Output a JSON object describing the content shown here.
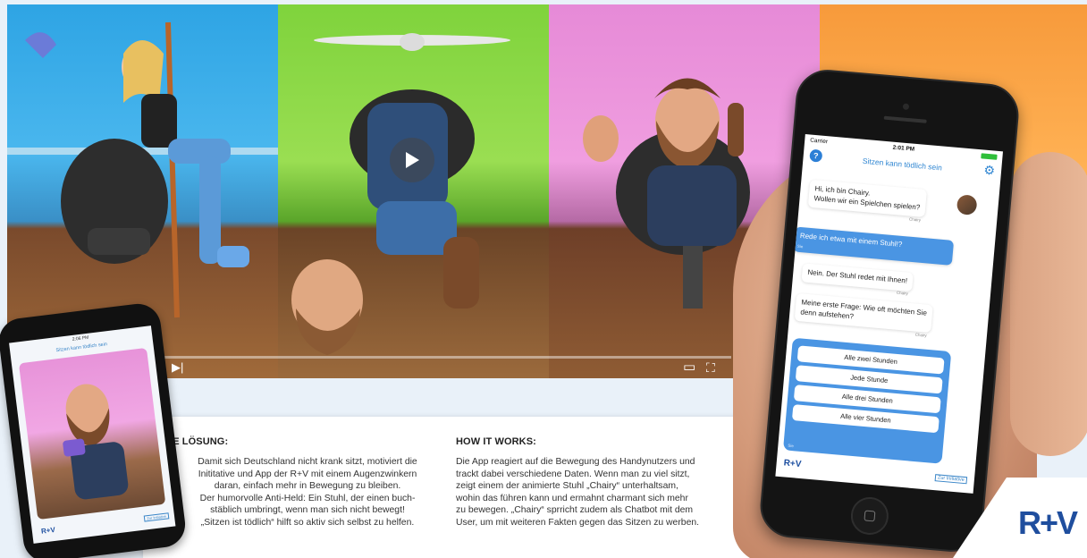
{
  "video": {
    "controls": {
      "play": "▶",
      "next": "▶|",
      "window": "▭",
      "fullscreen": "⛶"
    }
  },
  "card": {
    "solution": {
      "title": "DIE LÖSUNG:",
      "lines": [
        "Damit sich Deutschland nicht krank sitzt, motiviert die",
        "Inititative und App der R+V mit einem Augenzwinkern",
        "daran, einfach mehr in Bewegung zu bleiben.",
        "Der humorvolle Anti-Held: Ein Stuhl, der einen buch-",
        "stäblich umbringt, wenn man sich nicht bewegt!",
        "„Sitzen ist tödlich“ hilft so aktiv sich selbst zu helfen."
      ]
    },
    "how": {
      "title": "HOW IT WORKS:",
      "lines": [
        "Die App reagiert auf die Bewegung des Handynutzers und",
        "trackt dabei verschiedene Daten. Wenn man zu viel sitzt,",
        "zeigt einem der animierte Stuhl „Chairy“ unterhaltsam,",
        "wohin das führen kann und ermahnt charmant sich mehr",
        "zu bewegen. „Chairy“ sprricht zudem als Chatbot mit dem",
        "User, um  mit weiteren Fakten gegen das Sitzen zu werben."
      ]
    }
  },
  "phone_small": {
    "status_time": "2:06 PM",
    "title": "Sitzen kann tödlich sein",
    "logo": "R+V",
    "link": "Zur Initiative"
  },
  "phone_big": {
    "status": {
      "carrier": "Carrier",
      "time": "2:01 PM"
    },
    "title": "Sitzen kann tödlich sein",
    "messages": [
      {
        "from": "Chairy",
        "text1": "Hi, ich bin Chairy.",
        "text2": "Wollen wir ein Spielchen spielen?"
      },
      {
        "from": "Sie",
        "text1": "Rede ich etwa mit einem Stuhl!?",
        "text2": ""
      },
      {
        "from": "Chairy",
        "text1": "Nein. Der Stuhl redet mit Ihnen!",
        "text2": ""
      },
      {
        "from": "Chairy",
        "text1": "Meine erste Frage: Wie oft möchten Sie",
        "text2": "denn aufstehen?"
      }
    ],
    "options": [
      "Alle zwei Stunden",
      "Jede Stunde",
      "Alle drei Stunden",
      "Alle vier Stunden"
    ],
    "options_from": "Sie",
    "logo": "R+V",
    "link": "Zur Initiative"
  },
  "brand": {
    "logo": "R+V",
    "color": "#1f4e9e"
  }
}
